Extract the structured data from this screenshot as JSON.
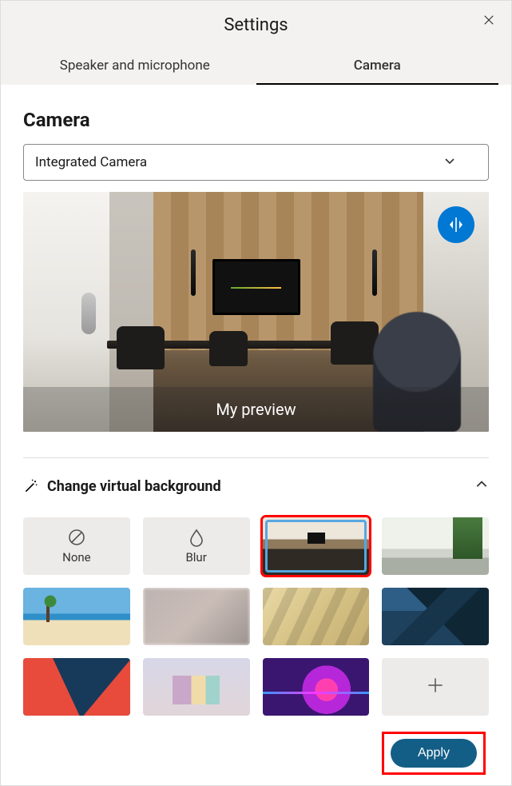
{
  "header": {
    "title": "Settings",
    "tabs": [
      {
        "label": "Speaker and microphone",
        "active": false
      },
      {
        "label": "Camera",
        "active": true
      }
    ]
  },
  "camera": {
    "heading": "Camera",
    "selected_device": "Integrated Camera",
    "preview_label": "My preview"
  },
  "virtual_background": {
    "title": "Change virtual background",
    "expanded": true,
    "items": [
      {
        "id": "none",
        "label": "None",
        "kind": "none",
        "selected": false
      },
      {
        "id": "blur",
        "label": "Blur",
        "kind": "blur",
        "selected": false
      },
      {
        "id": "room",
        "label": "",
        "kind": "image-room",
        "selected": true
      },
      {
        "id": "apartment",
        "label": "",
        "kind": "image-apartment",
        "selected": false
      },
      {
        "id": "beach",
        "label": "",
        "kind": "image-beach",
        "selected": false
      },
      {
        "id": "blurroom",
        "label": "",
        "kind": "image-blur1",
        "selected": false
      },
      {
        "id": "window",
        "label": "",
        "kind": "image-blur2",
        "selected": false
      },
      {
        "id": "mountains",
        "label": "",
        "kind": "image-mountains",
        "selected": false
      },
      {
        "id": "geometric",
        "label": "",
        "kind": "image-geometric",
        "selected": false
      },
      {
        "id": "3dshapes",
        "label": "",
        "kind": "image-3d",
        "selected": false
      },
      {
        "id": "neon",
        "label": "",
        "kind": "image-neon",
        "selected": false
      },
      {
        "id": "add",
        "label": "",
        "kind": "add",
        "selected": false
      }
    ]
  },
  "footer": {
    "apply_label": "Apply"
  },
  "annotations": {
    "selected_highlight": true,
    "apply_highlight": true
  }
}
